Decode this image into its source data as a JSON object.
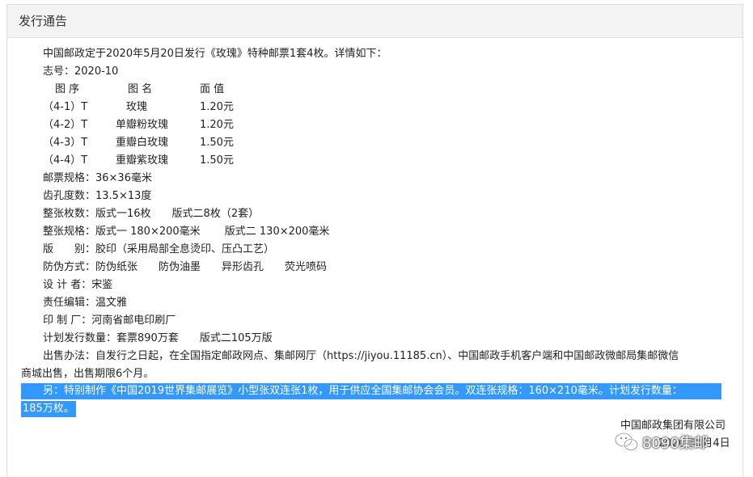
{
  "header": {
    "title": "发行通告"
  },
  "notice": {
    "intro": "中国邮政定于2020年5月20日发行《玫瑰》特种邮票1套4枚。详情如下：",
    "serial": "志号：2020-10",
    "table": {
      "headers": [
        "图 序",
        "图 名",
        "面 值"
      ],
      "rows": [
        [
          "（4-1）T",
          "玫瑰",
          "1.20元"
        ],
        [
          "（4-2）T",
          "单瓣粉玫瑰",
          "1.20元"
        ],
        [
          "（4-3）T",
          "重瓣白玫瑰",
          "1.50元"
        ],
        [
          "（4-4）T",
          "重瓣紫玫瑰",
          "1.50元"
        ]
      ]
    },
    "details": [
      "邮票规格：36×36毫米",
      "齿孔度数：13.5×13度",
      "整张枚数：版式一16枚　　版式二8枚（2套）",
      "整张规格：版式一 180×200毫米　　 版式二 130×200毫米",
      "版　　别：胶印（采用局部全息烫印、压凸工艺）",
      "防伪方式：防伪纸张　　防伪油墨　　异形齿孔　　荧光喷码",
      "设 计 者：宋鉴",
      "责任编辑：温文雅",
      "印 制 厂：河南省邮电印刷厂",
      "计划发行数量：套票890万套　　版式二105万版"
    ],
    "sale_line1": "出售办法：自发行之日起，在全国指定邮政网点、集邮网厅（https://jiyou.11185.cn）、中国邮政手机客户端和中国邮政微邮局集邮微信",
    "sale_line2": "商城出售，出售期限6个月。",
    "selected_line1": "另：特别制作《中国2019世界集邮展览》小型张双连张1枚，用于供应全国集邮协会会员。双连张规格：160×210毫米。计划发行数量：",
    "selected_line2": "185万枚。",
    "signature_org": "中国邮政集团有限公司",
    "signature_date": "2020年5月4日"
  },
  "watermark": {
    "text": "8090集邮",
    "icon": "wechat-icon"
  },
  "colors": {
    "selection": "#3399ff",
    "header_bg": "#f3f3f3"
  }
}
